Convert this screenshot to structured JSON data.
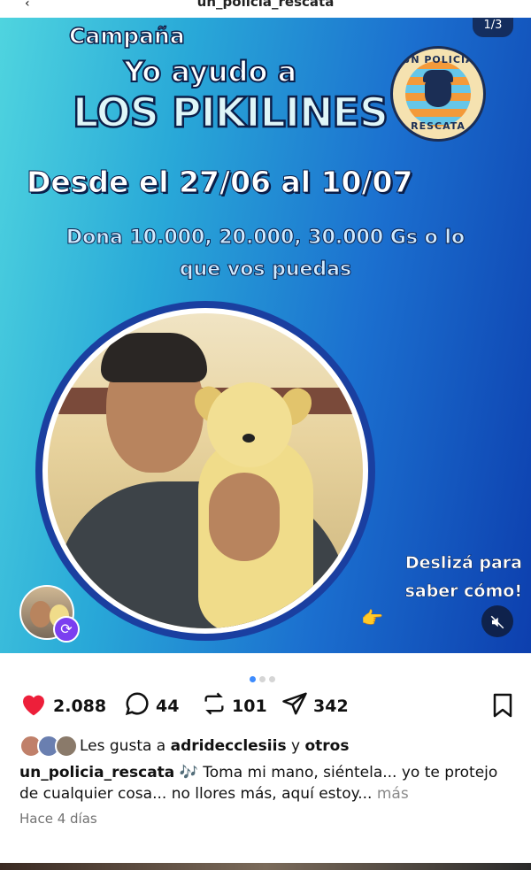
{
  "top": {
    "handle": "un_policia_rescata",
    "back_glyph": "‹"
  },
  "post": {
    "counter": "1/3",
    "title": {
      "campana": "Campaña",
      "line2": "Yo ayudo a",
      "line3": "LOS PIKILINES"
    },
    "logo": {
      "top": "UN POLICIA",
      "bottom": "RESCATA"
    },
    "dates": "Desde el 27/06 al 10/07",
    "donation": {
      "line1": "Dona 10.000, 20.000, 30.000 Gs o lo",
      "line2": "que vos puedas"
    },
    "swipe": {
      "line1": "Deslizá para",
      "line2": "saber cómo!",
      "emoji": "👉"
    },
    "mute_icon": "speaker-muted-icon"
  },
  "carousel": {
    "total": 3,
    "active": 0
  },
  "actions": {
    "likes": "2.088",
    "comments": "44",
    "reposts": "101",
    "shares": "342"
  },
  "liked_by": {
    "prefix": "Les gusta a ",
    "user": "adridecclesiis",
    "join": " y ",
    "others": "otros"
  },
  "caption": {
    "user": "un_policia_rescata",
    "text": " 🎶 Toma mi mano, siéntela... yo te protejo de cualquier cosa... no llores más, aquí estoy... ",
    "more": "más"
  },
  "time": "Hace 4 días",
  "colors": {
    "like": "#ed1f3a",
    "dot_active": "#3d8bfd",
    "repost_badge": "#7b3ff0"
  }
}
